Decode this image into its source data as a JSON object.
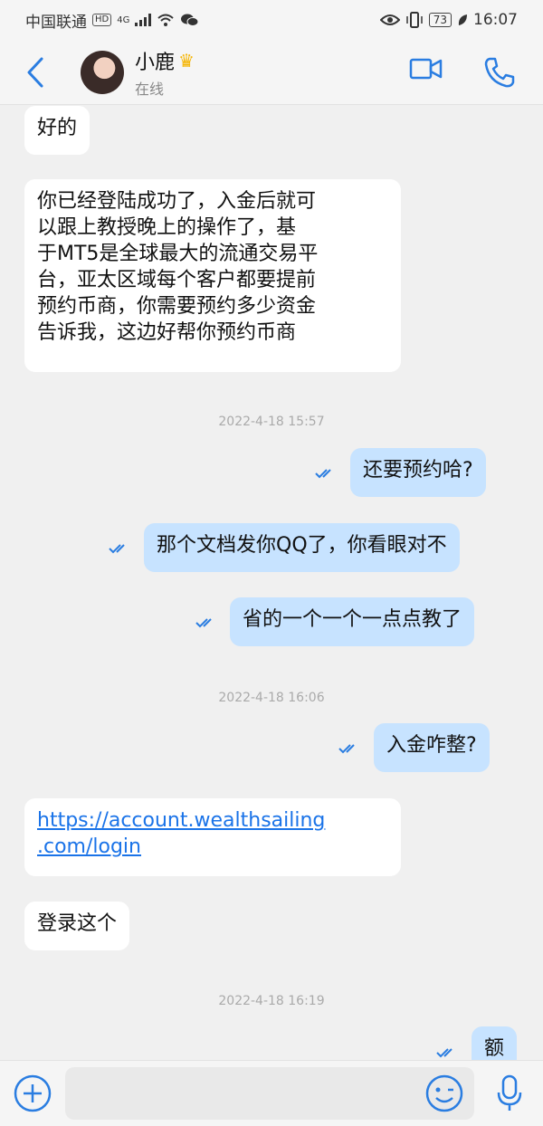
{
  "status_bar": {
    "carrier": "中国联通",
    "hd": "HD",
    "network": "4G",
    "battery": "73",
    "time": "16:07"
  },
  "header": {
    "contact_name": "小鹿",
    "contact_status": "在线"
  },
  "messages": [
    {
      "type": "in",
      "text": "好的"
    },
    {
      "type": "in",
      "lines": [
        "你已经登陆成功了，入金后就可",
        "以跟上教授晚上的操作了，基",
        "于MT5是全球最大的流通交易平",
        "台，亚太区域每个客户都要提前",
        "预约币商，你需要预约多少资金",
        "告诉我，这边好帮你预约币商"
      ]
    },
    {
      "type": "time",
      "text": "2022-4-18 15:57"
    },
    {
      "type": "out",
      "text": "还要预约哈?"
    },
    {
      "type": "out",
      "text": "那个文档发你QQ了，你看眼对不"
    },
    {
      "type": "out",
      "text": "省的一个一个一点点教了"
    },
    {
      "type": "time",
      "text": "2022-4-18 16:06"
    },
    {
      "type": "out",
      "text": "入金咋整?"
    },
    {
      "type": "in",
      "lines": [
        "https://account.wealthsailing",
        ".com/login"
      ]
    },
    {
      "type": "in",
      "text": "登录这个"
    },
    {
      "type": "time",
      "text": "2022-4-18 16:19"
    },
    {
      "type": "out",
      "text": "额"
    }
  ],
  "input": {
    "placeholder": ""
  },
  "colors": {
    "accent": "#2a7de1",
    "out_bubble": "#c7e3ff",
    "in_bubble": "#ffffff",
    "background": "#f0f0f0"
  },
  "icons": [
    "back-arrow-icon",
    "video-call-icon",
    "phone-icon",
    "plus-icon",
    "emoji-icon",
    "microphone-icon",
    "read-receipt-icon"
  ]
}
